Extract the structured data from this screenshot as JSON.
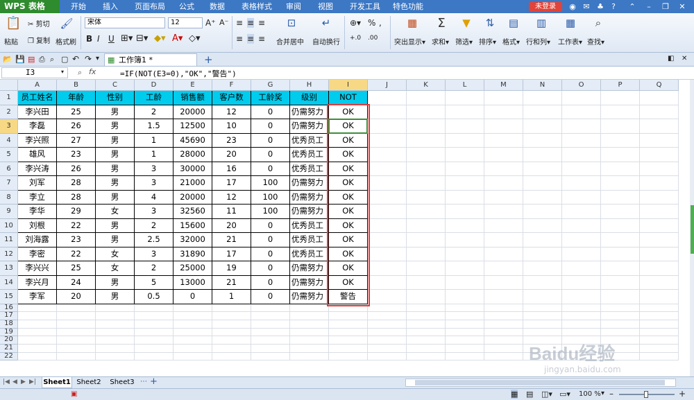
{
  "app": {
    "logo": "WPS 表格",
    "login": "未登录"
  },
  "menu": [
    "开始",
    "插入",
    "页面布局",
    "公式",
    "数据",
    "表格样式",
    "审阅",
    "视图",
    "开发工具",
    "特色功能"
  ],
  "ribbon": {
    "paste": "粘贴",
    "cut": "剪切",
    "copy": "复制",
    "format_painter": "格式刷",
    "font_name": "宋体",
    "font_size": "12",
    "merge_center": "合并居中",
    "wrap": "自动换行",
    "percent": "%",
    "highlight": "突出显示",
    "sum": "求和",
    "filter": "筛选",
    "sort": "排序",
    "format": "格式",
    "row_col": "行和列",
    "worksheet": "工作表",
    "find": "查找"
  },
  "doc_tab": "工作簿1 *",
  "formula_bar": {
    "cell_ref": "I3",
    "fx": "fx",
    "formula": "=IF(NOT(E3=0),\"OK\",\"警告\")"
  },
  "columns": [
    "A",
    "B",
    "C",
    "D",
    "E",
    "F",
    "G",
    "H",
    "I",
    "J",
    "K",
    "L",
    "M",
    "N",
    "O",
    "P",
    "Q"
  ],
  "rows": [
    "1",
    "2",
    "3",
    "4",
    "5",
    "6",
    "7",
    "8",
    "9",
    "10",
    "11",
    "12",
    "13",
    "14",
    "15",
    "16",
    "17",
    "18",
    "19",
    "20",
    "21",
    "22"
  ],
  "table": {
    "headers": [
      "员工姓名",
      "年龄",
      "性别",
      "工龄",
      "销售额",
      "客户数",
      "工龄奖",
      "级别",
      "NOT"
    ],
    "data": [
      [
        "李兴田",
        "25",
        "男",
        "2",
        "20000",
        "12",
        "0",
        "仍需努力",
        "OK"
      ],
      [
        "李磊",
        "26",
        "男",
        "1.5",
        "12500",
        "10",
        "0",
        "仍需努力",
        "OK"
      ],
      [
        "李兴照",
        "27",
        "男",
        "1",
        "45690",
        "23",
        "0",
        "优秀员工",
        "OK"
      ],
      [
        "雄风",
        "23",
        "男",
        "1",
        "28000",
        "20",
        "0",
        "优秀员工",
        "OK"
      ],
      [
        "李兴涛",
        "26",
        "男",
        "3",
        "30000",
        "16",
        "0",
        "优秀员工",
        "OK"
      ],
      [
        "刘军",
        "28",
        "男",
        "3",
        "21000",
        "17",
        "100",
        "仍需努力",
        "OK"
      ],
      [
        "李立",
        "28",
        "男",
        "4",
        "20000",
        "12",
        "100",
        "仍需努力",
        "OK"
      ],
      [
        "李华",
        "29",
        "女",
        "3",
        "32560",
        "11",
        "100",
        "仍需努力",
        "OK"
      ],
      [
        "刘根",
        "22",
        "男",
        "2",
        "15600",
        "20",
        "0",
        "优秀员工",
        "OK"
      ],
      [
        "刘海露",
        "23",
        "男",
        "2.5",
        "32000",
        "21",
        "0",
        "优秀员工",
        "OK"
      ],
      [
        "李密",
        "22",
        "女",
        "3",
        "31890",
        "17",
        "0",
        "优秀员工",
        "OK"
      ],
      [
        "李兴兴",
        "25",
        "女",
        "2",
        "25000",
        "19",
        "0",
        "仍需努力",
        "OK"
      ],
      [
        "李兴月",
        "24",
        "男",
        "5",
        "13000",
        "21",
        "0",
        "仍需努力",
        "OK"
      ],
      [
        "李军",
        "20",
        "男",
        "0.5",
        "0",
        "1",
        "0",
        "仍需努力",
        "警告"
      ]
    ]
  },
  "sheets": [
    "Sheet1",
    "Sheet2",
    "Sheet3"
  ],
  "status": {
    "zoom": "100 %"
  },
  "watermark": {
    "brand": "Baidu经验",
    "url": "jingyan.baidu.com"
  }
}
